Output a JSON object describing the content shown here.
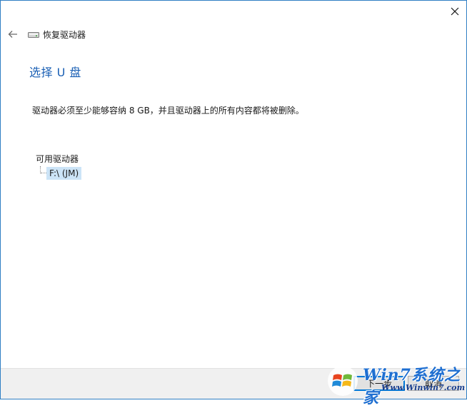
{
  "window": {
    "title": "恢复驱动器",
    "close_icon": "close-icon",
    "back_icon": "back-arrow-icon"
  },
  "page": {
    "heading": "选择 U 盘",
    "description": "驱动器必须至少能够容纳 8 GB，并且驱动器上的所有内容都将被删除。"
  },
  "drives": {
    "label": "可用驱动器",
    "items": [
      {
        "label": "F:\\ (JM)",
        "selected": true
      }
    ]
  },
  "footer": {
    "next_label": "下一步",
    "cancel_label": "取消"
  },
  "watermark": {
    "title": "Win7系统之家",
    "url": "Www.Winwin7.com"
  },
  "colors": {
    "heading": "#1a5fb4",
    "selection": "#cce4f7",
    "border": "#2f7fc4",
    "footer_bg": "#f0f0f0"
  }
}
